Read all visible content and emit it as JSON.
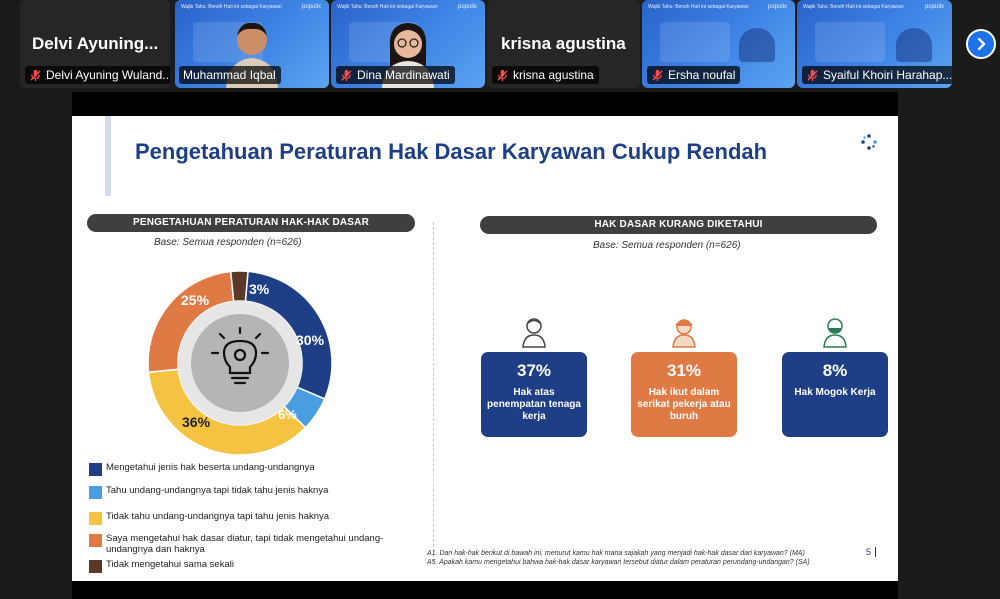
{
  "participants": [
    {
      "display": "Delvi  Ayuning...",
      "label": "Delvi Ayuning Wuland...",
      "type": "name",
      "muted": true,
      "active": false
    },
    {
      "label": "Muhammad Iqbal",
      "type": "video",
      "muted": false,
      "active": true
    },
    {
      "label": "Dina Mardinawati",
      "type": "video",
      "muted": true,
      "active": false
    },
    {
      "display": "krisna agustina",
      "label": "krisna agustina",
      "type": "name",
      "muted": true,
      "active": false
    },
    {
      "label": "Ersha noufal",
      "type": "video",
      "muted": true,
      "active": false
    },
    {
      "label": "Syaiful Khoiri Harahap...",
      "type": "video",
      "muted": true,
      "active": false
    }
  ],
  "thumb_header": "Wajib Tahu: Bersih Hati ini sebagai Karyawan",
  "thumb_brand": "populix",
  "slide": {
    "title": "Pengetahuan Peraturan Hak Dasar Karyawan Cukup Rendah",
    "left_pill": "PENGETAHUAN PERATURAN HAK-HAK DASAR",
    "right_pill": "HAK DASAR KURANG DIKETAHUI",
    "base_left": "Base: Semua responden (n=626)",
    "base_right": "Base: Semua responden (n=626)",
    "footnote_1": "A1. Dari hak-hak berikut di bawah ini, menurut kamu hak mana sajakah yang menjadi hak-hak dasar dari karyawan? (MA)",
    "footnote_2": "A5. Apakah kamu mengetahui bahwa hak-hak dasar karyawan tersebut diatur dalam peraturan perundang-undangan? (SA)",
    "page_number": "5",
    "cards": [
      {
        "value": "37%",
        "label": "Hak atas penempatan tenaga kerja",
        "color": "#1e3f85"
      },
      {
        "value": "31%",
        "label": "Hak ikut dalam serikat pekerja atau buruh",
        "color": "#e07a45"
      },
      {
        "value": "8%",
        "label": "Hak Mogok Kerja",
        "color": "#1e3f85"
      }
    ]
  },
  "chart_data": {
    "type": "pie",
    "variant": "donut",
    "title": "PENGETAHUAN PERATURAN HAK-HAK DASAR",
    "categories": [
      "Mengetahui jenis hak beserta undang-undangnya",
      "Tahu undang-undangnya tapi tidak tahu jenis haknya",
      "Tidak tahu undang-undangnya tapi tahu jenis haknya",
      "Saya mengetahui hak dasar diatur, tapi tidak mengetahui undang-undangnya dan haknya",
      "Tidak mengetahui sama sekali"
    ],
    "values": [
      30,
      6,
      36,
      25,
      3
    ],
    "labels": [
      "30%",
      "6%",
      "36%",
      "25%",
      "3%"
    ],
    "colors": [
      "#1e3f85",
      "#4a9de0",
      "#f5c342",
      "#e07a45",
      "#5a3a26"
    ],
    "legend_position": "bottom-left"
  }
}
